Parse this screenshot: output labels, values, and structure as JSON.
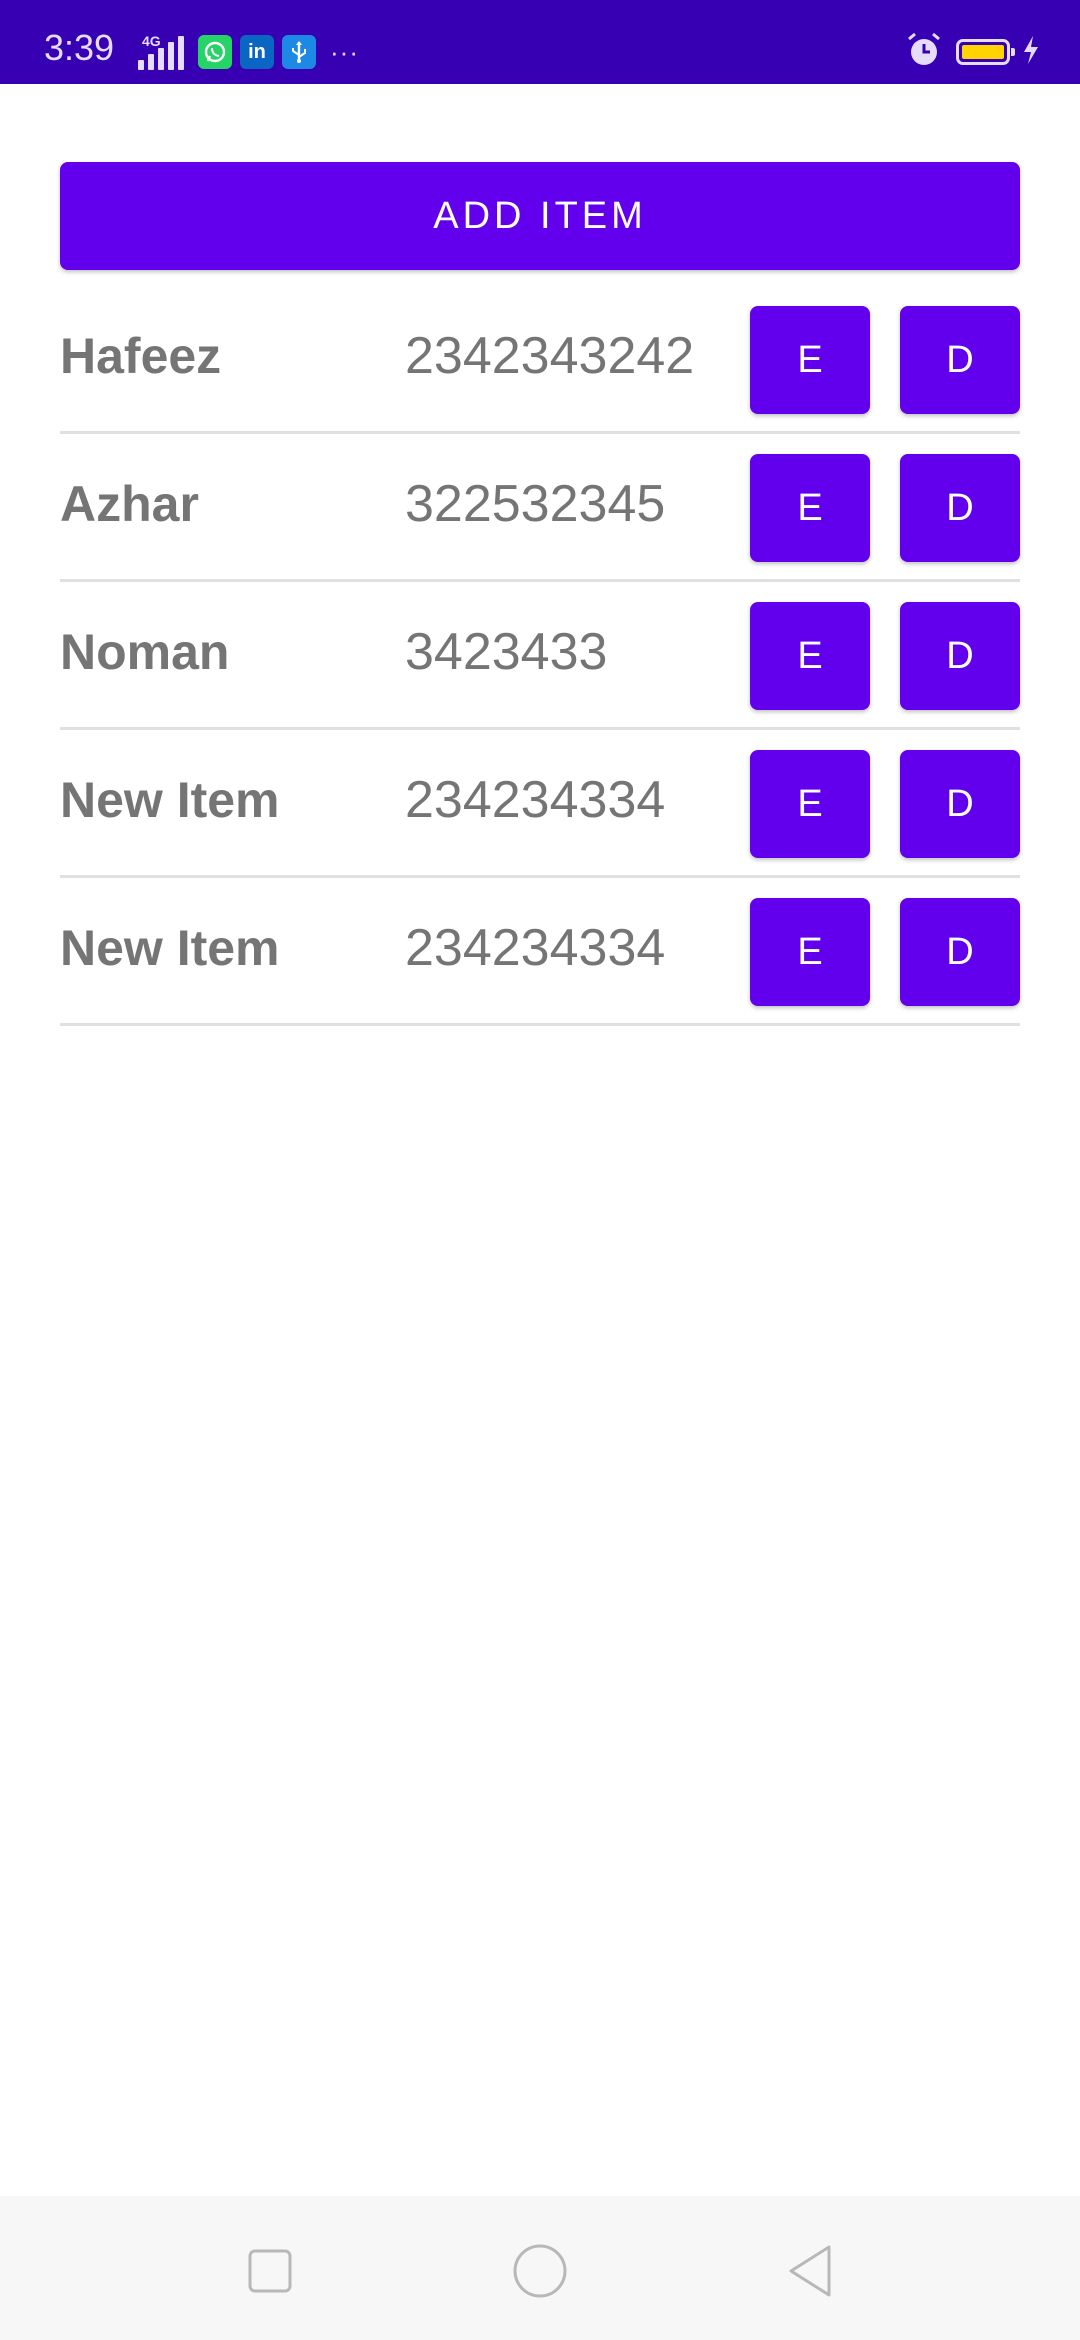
{
  "status_bar": {
    "time": "3:39",
    "network": "4G",
    "background_color": "#3700b3",
    "left_icons": [
      "signal-icon",
      "whatsapp-icon",
      "linkedin-icon",
      "usb-icon",
      "more-notifications-icon"
    ],
    "right_icons": [
      "alarm-icon",
      "battery-icon",
      "charging-icon"
    ],
    "battery_color": "#ffd400"
  },
  "add_button": {
    "label": "ADD ITEM"
  },
  "items": [
    {
      "name": "Hafeez",
      "number": "2342343242",
      "edit_label": "E",
      "delete_label": "D"
    },
    {
      "name": "Azhar",
      "number": "322532345",
      "edit_label": "E",
      "delete_label": "D"
    },
    {
      "name": "Noman",
      "number": "3423433",
      "edit_label": "E",
      "delete_label": "D"
    },
    {
      "name": "New Item",
      "number": "234234334",
      "edit_label": "E",
      "delete_label": "D"
    },
    {
      "name": "New Item",
      "number": "234234334",
      "edit_label": "E",
      "delete_label": "D"
    }
  ],
  "nav_bar": {
    "buttons": [
      "recents-square-icon",
      "home-circle-icon",
      "back-triangle-icon"
    ]
  },
  "colors": {
    "accent": "#6200ee",
    "text": "#757575",
    "divider": "#e0e0e0"
  }
}
